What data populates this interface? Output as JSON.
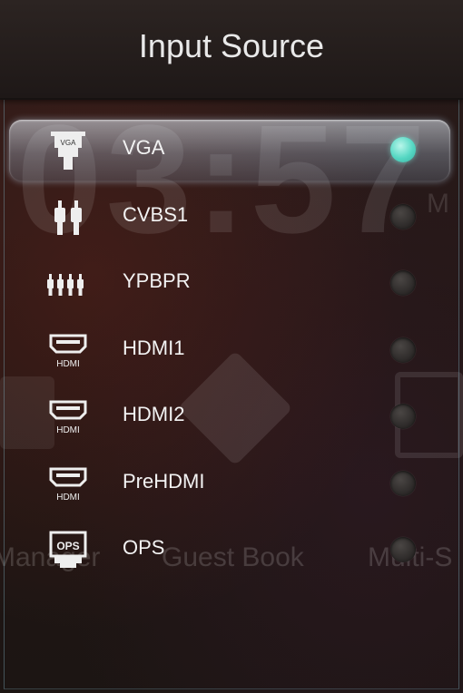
{
  "title": "Input Source",
  "background": {
    "clock_text": "03:57",
    "side_letter": "M",
    "labels": [
      "Manager",
      "Guest Book",
      "Multi-S"
    ]
  },
  "sources": [
    {
      "label": "VGA",
      "icon": "vga-connector-icon",
      "icon_text": "VGA",
      "selected": true
    },
    {
      "label": "CVBS1",
      "icon": "rca-cvbs-icon",
      "icon_text": "",
      "selected": false
    },
    {
      "label": "YPBPR",
      "icon": "component-ypbpr-icon",
      "icon_text": "",
      "selected": false
    },
    {
      "label": "HDMI1",
      "icon": "hdmi-port-icon",
      "icon_text": "HDMI",
      "selected": false
    },
    {
      "label": "HDMI2",
      "icon": "hdmi-port-icon",
      "icon_text": "HDMI",
      "selected": false
    },
    {
      "label": "PreHDMI",
      "icon": "hdmi-port-icon",
      "icon_text": "HDMI",
      "selected": false
    },
    {
      "label": "OPS",
      "icon": "ops-module-icon",
      "icon_text": "OPS",
      "selected": false
    }
  ],
  "colors": {
    "selected_radio": "#55d7c3",
    "text": "#f2f2f2"
  }
}
